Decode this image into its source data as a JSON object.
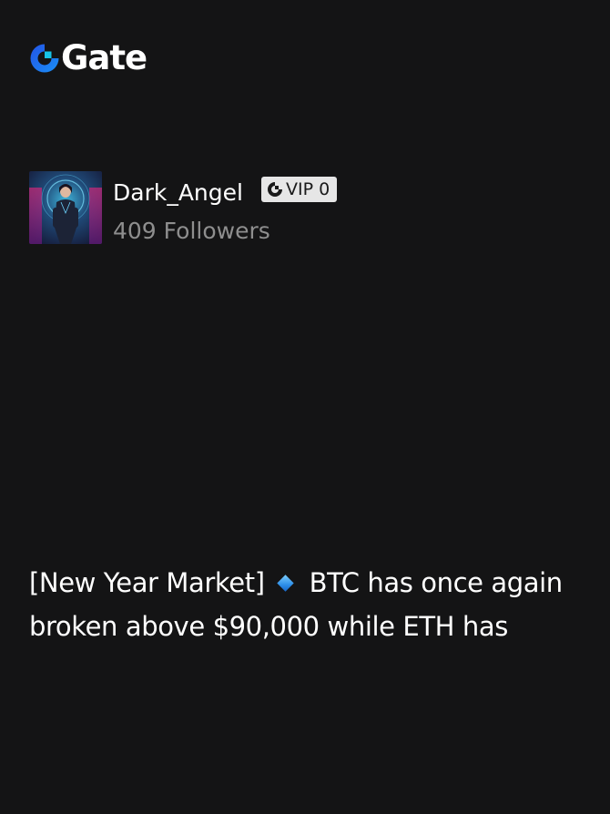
{
  "brand": {
    "name": "Gate",
    "logo_icon": "gate-logo-icon",
    "accent_color": "#1d6bf3",
    "accent_light": "#17c3e8"
  },
  "author": {
    "name": "Dark_Angel",
    "avatar_icon": "avatar-image",
    "vip_badge": "VIP 0",
    "vip_icon": "gate-mini-icon",
    "followers": "409 Followers"
  },
  "post": {
    "text_before_icon": "[New Year Market]",
    "bullet_icon": "blue-diamond-icon",
    "text_after_icon": "BTC has once again broken above $90,000 while ETH has"
  },
  "colors": {
    "background": "#141415",
    "text_primary": "#ffffff",
    "text_secondary": "#8e8e8e",
    "badge_bg": "#e6e6e6"
  }
}
